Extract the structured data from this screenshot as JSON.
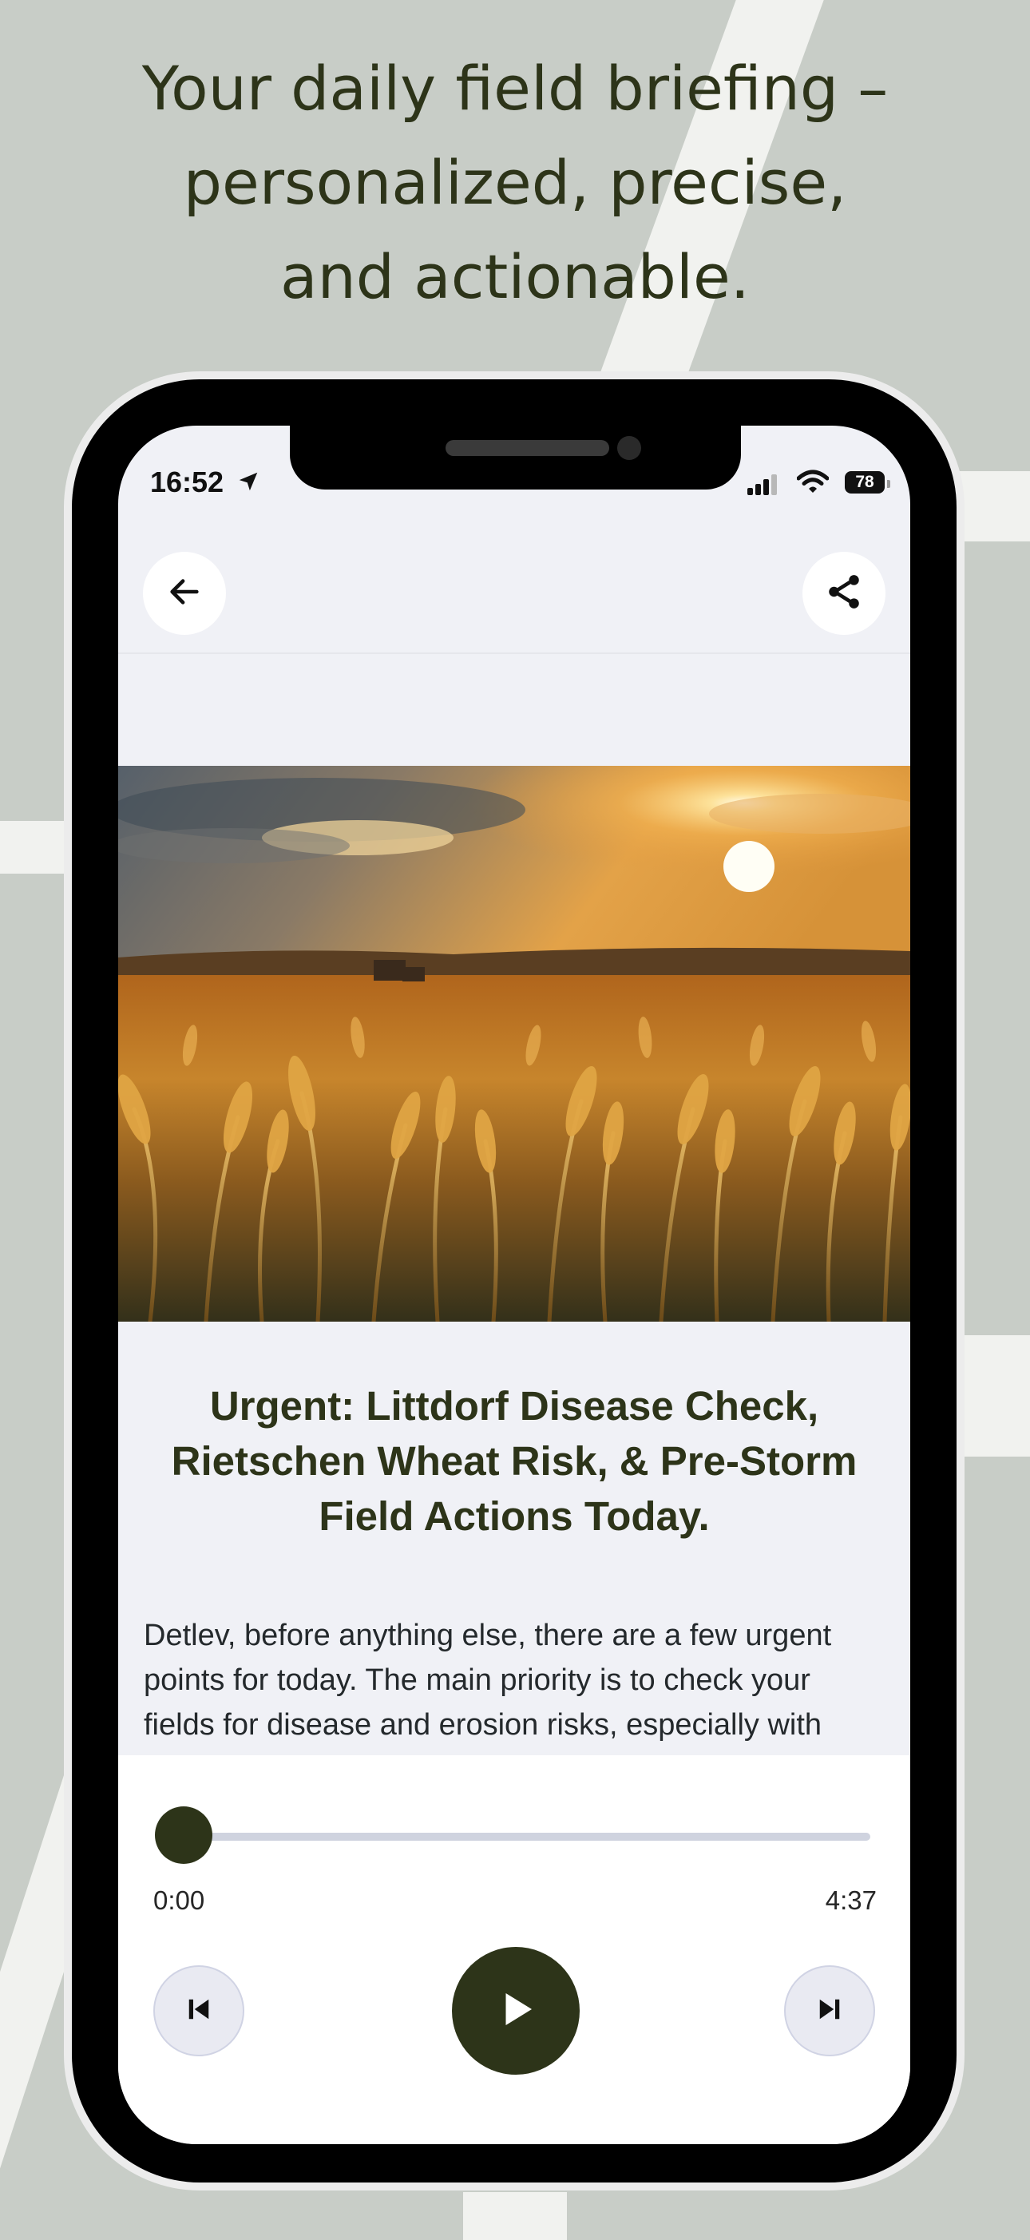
{
  "headline": {
    "lines": [
      "Your daily field briefing –",
      "personalized, precise,",
      "and actionable."
    ]
  },
  "status_bar": {
    "time": "16:52",
    "battery": "78",
    "icons": [
      "location-arrow-icon",
      "cellular-signal-icon",
      "wifi-icon",
      "battery-icon"
    ]
  },
  "nav": {
    "back_icon": "arrow-left-icon",
    "share_icon": "share-icon"
  },
  "article": {
    "title": "Urgent: Littdorf Disease Check, Rietschen Wheat Risk, & Pre-Storm Field Actions Today.",
    "body": "Detlev, before anything else, there are a few urgent points for today. The main priority is to check your fields for disease and erosion risks, especially with"
  },
  "player": {
    "current_time": "0:00",
    "total_time": "4:37",
    "progress": 0,
    "icons": [
      "skip-previous-icon",
      "play-icon",
      "skip-next-icon"
    ]
  },
  "colors": {
    "background": "#c8cdc7",
    "accent": "#2d3419",
    "screen": "#f0f1f6",
    "track": "#cfd3df"
  }
}
